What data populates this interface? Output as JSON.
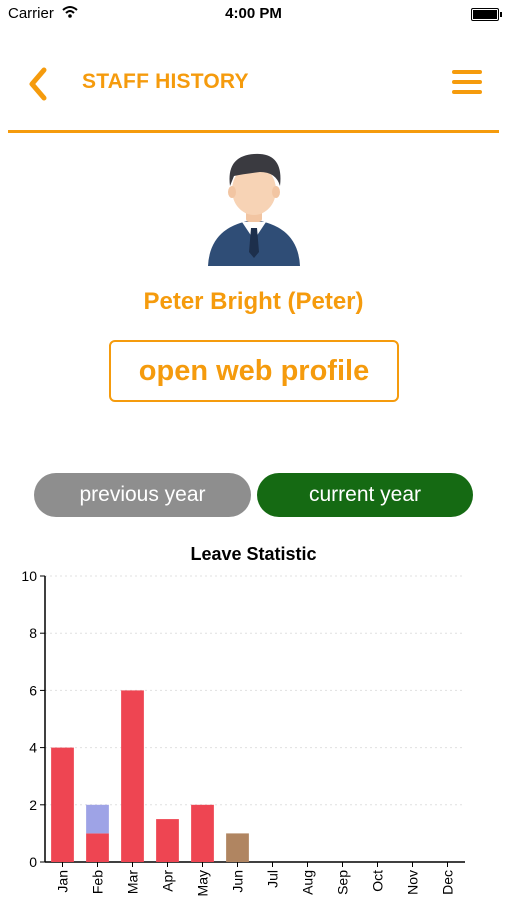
{
  "status_bar": {
    "carrier": "Carrier",
    "time": "4:00 PM"
  },
  "header": {
    "title": "STAFF HISTORY"
  },
  "profile": {
    "name": "Peter Bright (Peter)",
    "web_profile_button": "open web profile"
  },
  "year_toggle": {
    "previous": "previous year",
    "current": "current year",
    "selected": "current year"
  },
  "colors": {
    "accent": "#f59b0d",
    "current_year": "#156a13",
    "previous_year": "#8e8e8e",
    "bar_red": "#ee4552",
    "bar_purple": "#9ea3e6",
    "bar_brown": "#b08561"
  },
  "chart_data": {
    "type": "bar",
    "stacked": true,
    "title": "Leave Statistic",
    "categories": [
      "Jan",
      "Feb",
      "Mar",
      "Apr",
      "May",
      "Jun",
      "Jul",
      "Aug",
      "Sep",
      "Oct",
      "Nov",
      "Dec"
    ],
    "series": [
      {
        "color": "#ee4552",
        "values": [
          4,
          1,
          6,
          1.5,
          2,
          0,
          0,
          0,
          0,
          0,
          0,
          0
        ]
      },
      {
        "color": "#9ea3e6",
        "values": [
          0,
          1,
          0,
          0,
          0,
          0,
          0,
          0,
          0,
          0,
          0,
          0
        ]
      },
      {
        "color": "#b08561",
        "values": [
          0,
          0,
          0,
          0,
          0,
          1,
          0,
          0,
          0,
          0,
          0,
          0
        ]
      }
    ],
    "ylim": [
      0,
      10
    ],
    "yticks": [
      "0",
      "2",
      "4",
      "6",
      "8",
      "10"
    ],
    "grid": true
  }
}
